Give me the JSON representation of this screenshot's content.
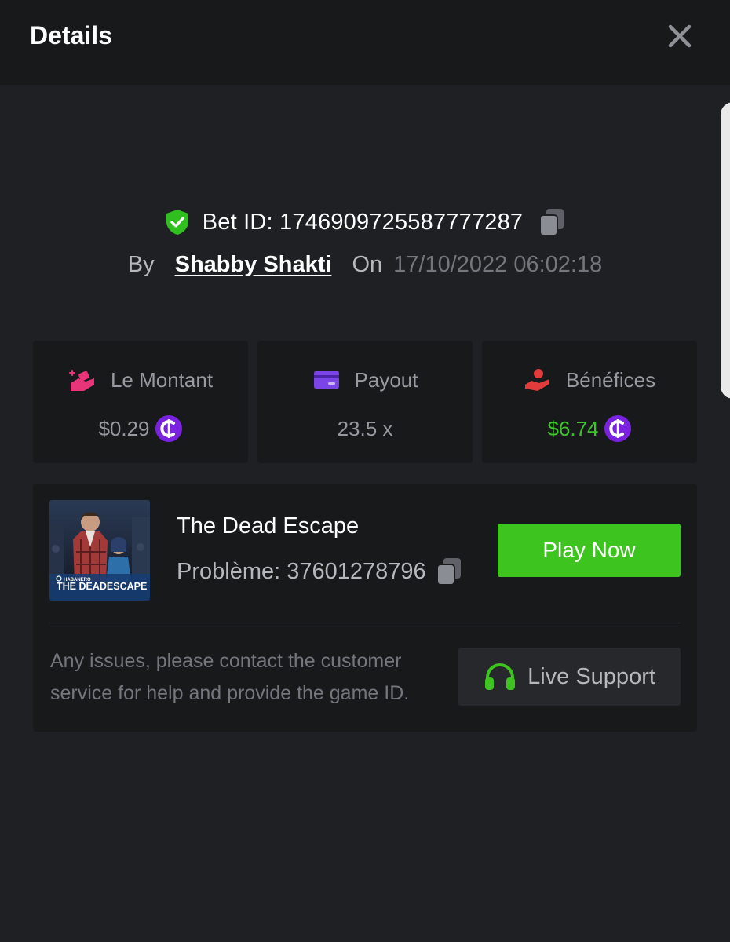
{
  "header": {
    "title": "Details",
    "close_icon": "close-icon"
  },
  "bet": {
    "id_text": "Bet ID: 1746909725587777287",
    "by_label": "By",
    "user": "Shabby Shakti",
    "on_label": "On",
    "date": "17/10/2022 06:02:18"
  },
  "stats": [
    {
      "label": "Le Montant",
      "value": "$0.29",
      "icon": "money-hand-icon",
      "has_coin": true
    },
    {
      "label": "Payout",
      "value": "23.5 x",
      "icon": "card-icon",
      "has_coin": false
    },
    {
      "label": "Bénéfices",
      "value": "$6.74",
      "icon": "profit-hand-icon",
      "has_coin": true
    }
  ],
  "game": {
    "title": "The Dead Escape",
    "problem": "Problème: 37601278796",
    "play_label": "Play Now",
    "thumb_brand": "HABANERO",
    "thumb_title": "THE DEADESCAPE"
  },
  "support": {
    "text": "Any issues, please contact the customer service for help and provide the game ID.",
    "button_label": "Live Support"
  },
  "colors": {
    "accent_green": "#3dc41f",
    "profit_green": "#3dc52a",
    "coin_purple": "#7a22e0",
    "card_purple": "#7b44e6",
    "pink": "#e8357a",
    "red": "#e23b3b"
  }
}
